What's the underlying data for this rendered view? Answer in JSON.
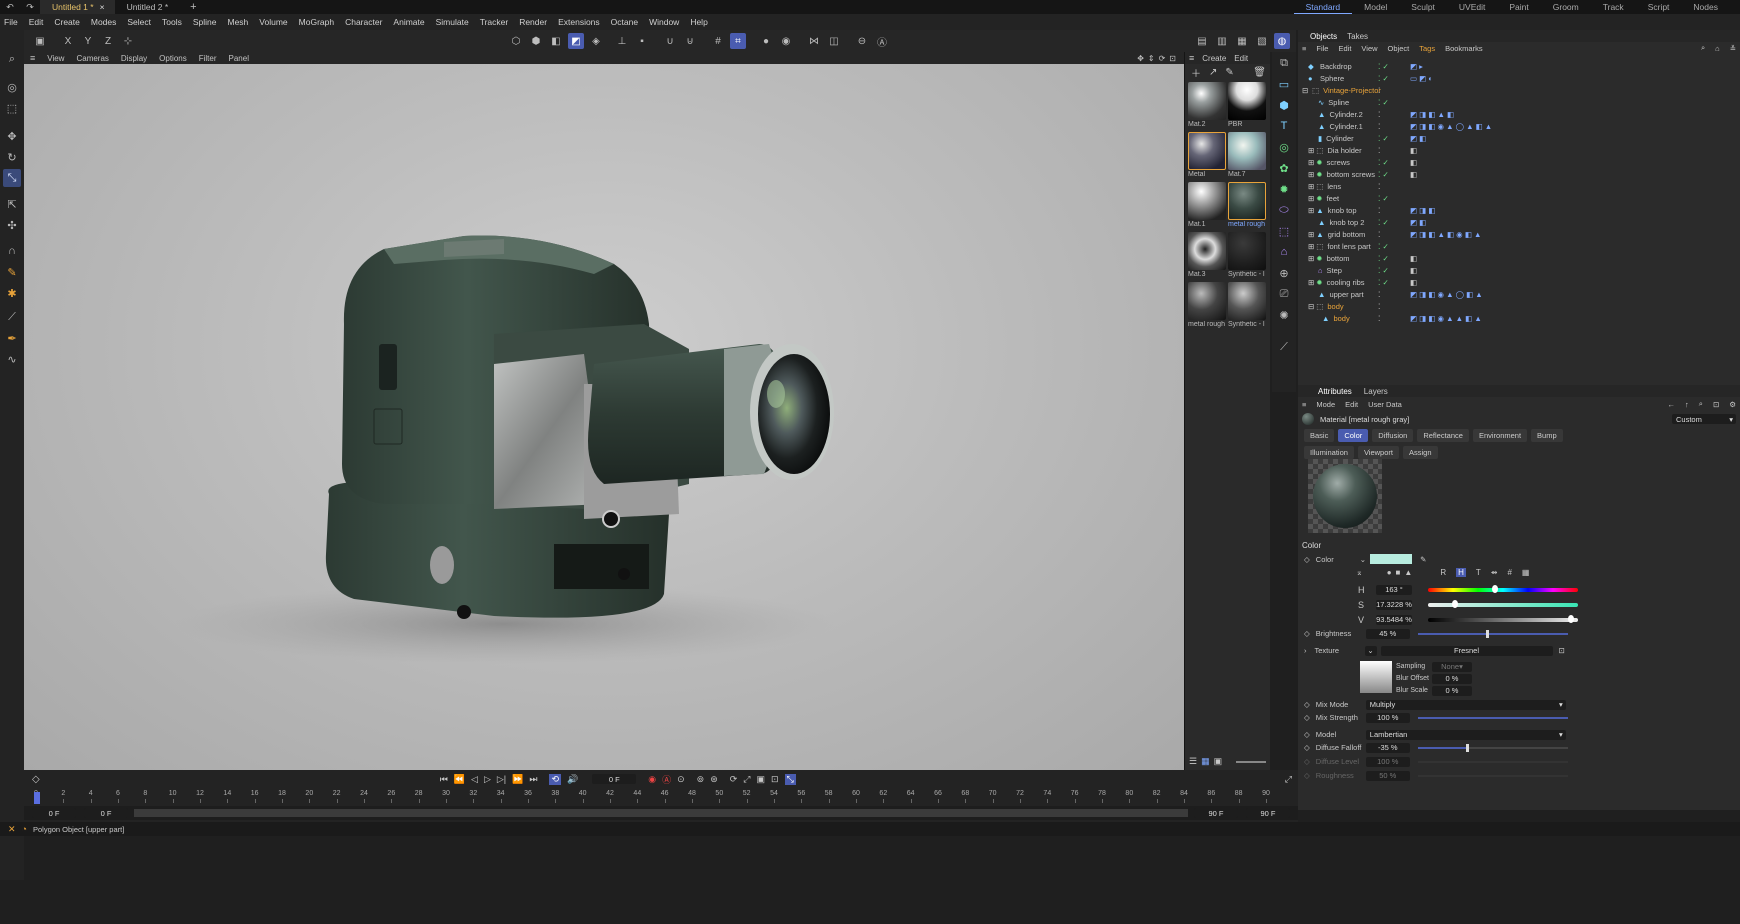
{
  "titlebar": {
    "tabs": [
      {
        "label": "Untitled 1 *"
      },
      {
        "label": "Untitled 2 *"
      }
    ],
    "new_tab": "+",
    "layouts": [
      "Standard",
      "Model",
      "Sculpt",
      "UVEdit",
      "Paint",
      "Groom",
      "Track",
      "Script",
      "Nodes"
    ]
  },
  "menubar": [
    "File",
    "Edit",
    "Create",
    "Modes",
    "Select",
    "Tools",
    "Spline",
    "Mesh",
    "Volume",
    "MoGraph",
    "Character",
    "Animate",
    "Simulate",
    "Tracker",
    "Render",
    "Extensions",
    "Octane",
    "Window",
    "Help"
  ],
  "axis_buttons": [
    "X",
    "Y",
    "Z"
  ],
  "viewport_menu": [
    "View",
    "Cameras",
    "Display",
    "Options",
    "Filter",
    "Panel"
  ],
  "material_menu": [
    "Create",
    "Edit"
  ],
  "materials": [
    {
      "label": "Mat.2"
    },
    {
      "label": "PBR"
    },
    {
      "label": "Metal"
    },
    {
      "label": "Mat.7"
    },
    {
      "label": "Mat.1"
    },
    {
      "label": "metal rough"
    },
    {
      "label": "Mat.3"
    },
    {
      "label": "Synthetic - l"
    },
    {
      "label": "metal rough"
    },
    {
      "label": "Synthetic - l"
    }
  ],
  "objects": {
    "tabs": [
      "Objects",
      "Takes"
    ],
    "menu": [
      "File",
      "Edit",
      "View",
      "Object",
      "Tags",
      "Bookmarks"
    ],
    "rows": [
      {
        "name": "Backdrop"
      },
      {
        "name": "Sphere"
      },
      {
        "name": "Vintage-Projector"
      },
      {
        "name": "Spline"
      },
      {
        "name": "Cylinder.2"
      },
      {
        "name": "Cylinder.1"
      },
      {
        "name": "Cylinder"
      },
      {
        "name": "Dia holder"
      },
      {
        "name": "screws"
      },
      {
        "name": "bottom screws"
      },
      {
        "name": "lens"
      },
      {
        "name": "feet"
      },
      {
        "name": "knob top"
      },
      {
        "name": "knob top 2"
      },
      {
        "name": "grid bottom"
      },
      {
        "name": "font lens part"
      },
      {
        "name": "bottom"
      },
      {
        "name": "Step"
      },
      {
        "name": "cooling ribs"
      },
      {
        "name": "upper part"
      },
      {
        "name": "body"
      },
      {
        "name": "body"
      }
    ]
  },
  "attributes": {
    "tabs": [
      "Attributes",
      "Layers"
    ],
    "menu": [
      "Mode",
      "Edit",
      "User Data"
    ],
    "material_title": "Material [metal rough gray]",
    "preset": "Custom",
    "channel_tabs": [
      "Basic",
      "Color",
      "Diffusion",
      "Reflectance",
      "Environment",
      "Bump",
      "Illumination",
      "Viewport",
      "Assign"
    ],
    "section": "Color",
    "color_label": "Color",
    "color_swatch": "#b7ecdf",
    "mode_buttons": [
      "R",
      "H",
      "T",
      "#"
    ],
    "h_label": "H",
    "h_value": "163 °",
    "s_label": "S",
    "s_value": "17.3228 %",
    "v_label": "V",
    "v_value": "93.5484 %",
    "brightness_label": "Brightness",
    "brightness_value": "45 %",
    "texture_label": "Texture",
    "texture_value": "Fresnel",
    "sampling_label": "Sampling",
    "sampling_value": "None",
    "blur_offset_label": "Blur Offset",
    "blur_offset_value": "0 %",
    "blur_scale_label": "Blur Scale",
    "blur_scale_value": "0 %",
    "mix_mode_label": "Mix Mode",
    "mix_mode_value": "Multiply",
    "mix_strength_label": "Mix Strength",
    "mix_strength_value": "100 %",
    "model_label": "Model",
    "model_value": "Lambertian",
    "diffuse_falloff_label": "Diffuse Falloff",
    "diffuse_falloff_value": "-35 %",
    "diffuse_level_label": "Diffuse Level",
    "diffuse_level_value": "100 %",
    "roughness_label": "Roughness",
    "roughness_value": "50 %"
  },
  "timeline": {
    "current_frame": "0 F",
    "start": "0 F",
    "start2": "0 F",
    "end": "90 F",
    "end2": "90 F",
    "ticks": [
      "0",
      "2",
      "4",
      "6",
      "8",
      "10",
      "12",
      "14",
      "16",
      "18",
      "20",
      "22",
      "24",
      "26",
      "28",
      "30",
      "32",
      "34",
      "36",
      "38",
      "40",
      "42",
      "44",
      "46",
      "48",
      "50",
      "52",
      "54",
      "56",
      "58",
      "60",
      "62",
      "64",
      "66",
      "68",
      "70",
      "72",
      "74",
      "76",
      "78",
      "80",
      "82",
      "84",
      "86",
      "88",
      "90"
    ]
  },
  "status": "Polygon Object [upper part]",
  "colors": {
    "accent": "#4a5cb0",
    "highlight": "#e8a33a",
    "body": "#3d4f45"
  }
}
